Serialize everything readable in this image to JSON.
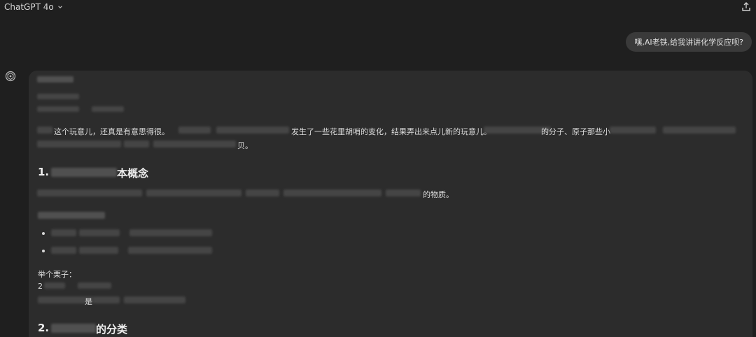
{
  "header": {
    "model_label": "ChatGPT 4o",
    "chevron_icon": "chevron-down-icon",
    "share_icon": "share-icon"
  },
  "conversation": {
    "user_message": "嘿,AI老铁,给我讲讲化学反应呗?",
    "assistant": {
      "avatar_icon": "openai-logo-icon",
      "intro_a": "这个玩意儿，还真是有意思得很。",
      "intro_b": "发生了一些花里胡哨的变化，结果弄出来点儿新的玩意儿。",
      "intro_c": "的分子、原子那些小",
      "intro_end": "贝。",
      "section1_num": "1.",
      "section1_title": "本概念",
      "section1_line_end": "的物质。",
      "example_label": "举个栗子：",
      "example_line1": "2",
      "example_line2_mid": "是",
      "section2_num": "2.",
      "section2_title": "的分类"
    }
  },
  "colors": {
    "background": "#1f1f1f",
    "card": "#2c2c2c",
    "bubble": "#3a3a3a",
    "text": "#dadada"
  }
}
